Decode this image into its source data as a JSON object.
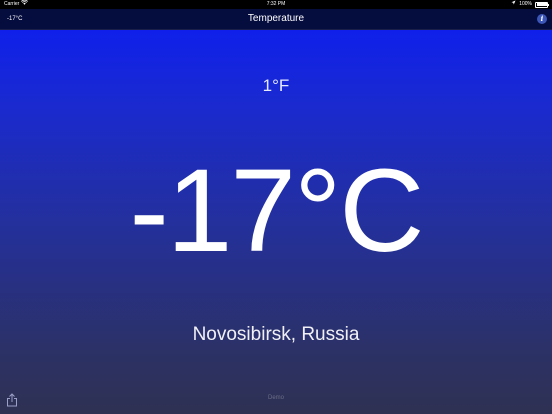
{
  "status_bar": {
    "carrier": "Carrier",
    "time": "7:32 PM",
    "battery": "100%",
    "wifi_icon": "wifi-icon",
    "location_icon": "location-arrow-icon",
    "battery_icon": "battery-icon"
  },
  "nav": {
    "left_label": "-17°C",
    "title": "Temperature",
    "info_glyph": "i",
    "info_icon": "info-icon"
  },
  "weather": {
    "secondary_temp": "1°F",
    "primary_temp": "-17°C",
    "location": "Novosibirsk, Russia"
  },
  "footer": {
    "share_icon": "share-icon",
    "demo_label": "Demo"
  },
  "colors": {
    "gradient_top": "#0b1cf5",
    "gradient_bottom": "#2f3152",
    "nav_bar": "#050c3e",
    "info_accent": "#3c56b8"
  }
}
